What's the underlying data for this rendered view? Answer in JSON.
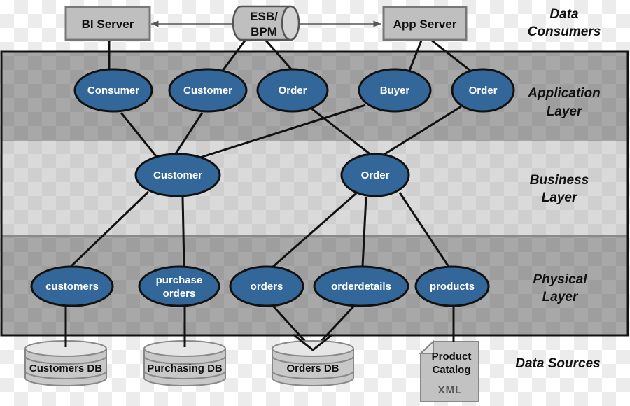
{
  "colors": {
    "node_fill": "#336699",
    "node_stroke": "#111111",
    "box_fill": "#bfbfbf",
    "box_stroke": "#777777",
    "app_layer": "#a8a8a8",
    "business_layer": "#d9d9d9",
    "physical_layer": "#a8a8a8",
    "db_fill": "#c8c8c8"
  },
  "consumers": {
    "bi_server": "BI Server",
    "esb_line1": "ESB/",
    "esb_line2": "BPM",
    "app_server": "App Server"
  },
  "layer_labels": {
    "consumers": [
      "Data",
      "Consumers"
    ],
    "application": [
      "Application",
      "Layer"
    ],
    "business": [
      "Business",
      "Layer"
    ],
    "physical": [
      "Physical",
      "Layer"
    ],
    "sources": [
      "Data Sources"
    ]
  },
  "application_nodes": [
    "Consumer",
    "Customer",
    "Order",
    "Buyer",
    "Order"
  ],
  "business_nodes": [
    "Customer",
    "Order"
  ],
  "physical_nodes": {
    "customers": "customers",
    "purchase_line1": "purchase",
    "purchase_line2": "orders",
    "orders": "orders",
    "orderdetails": "orderdetails",
    "products": "products"
  },
  "sources": {
    "customers_db": "Customers DB",
    "purchasing_db": "Purchasing DB",
    "orders_db": "Orders DB",
    "catalog_line1": "Product",
    "catalog_line2": "Catalog",
    "catalog_format": "XML"
  }
}
